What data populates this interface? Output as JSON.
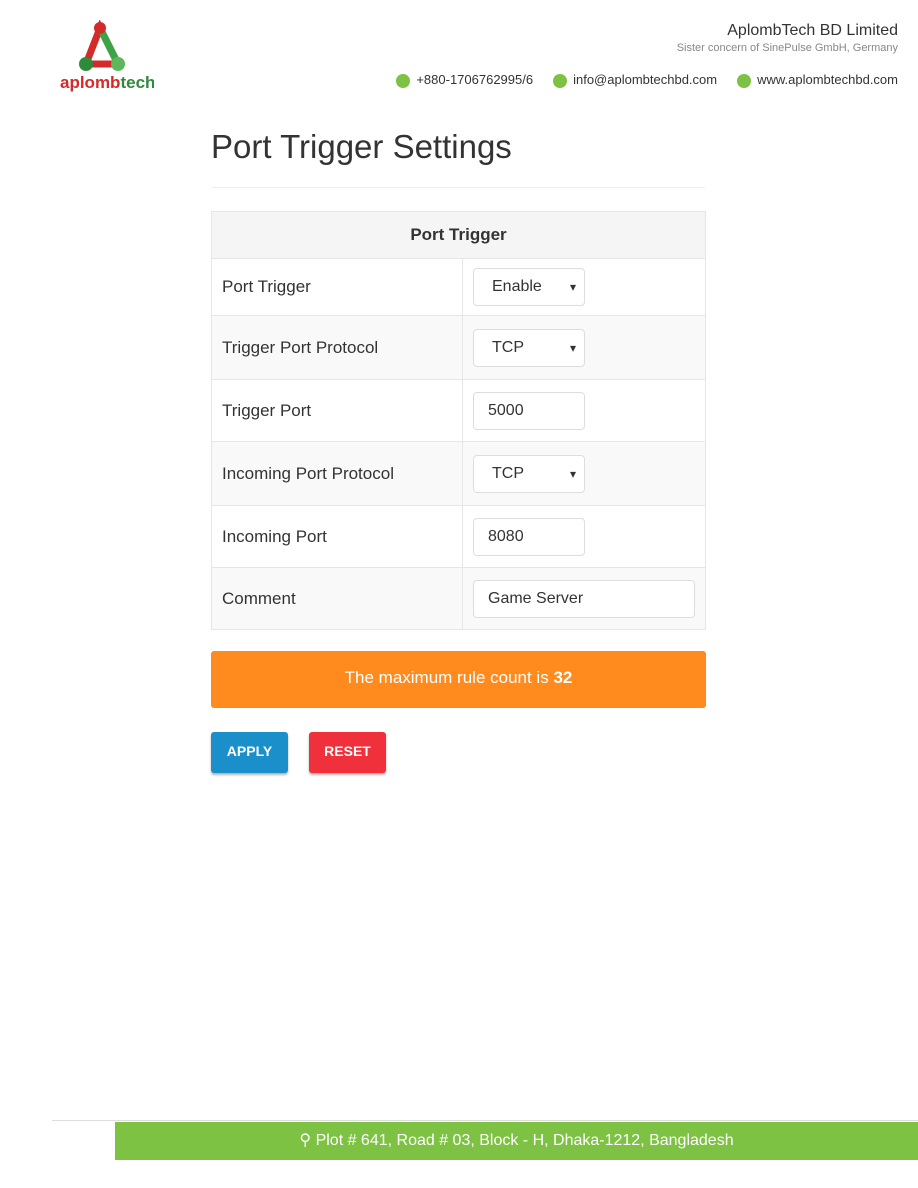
{
  "header": {
    "logo_text": "aplombtech",
    "company": "AplombTech BD Limited",
    "sister": "Sister concern of SinePulse GmbH, Germany",
    "contacts": [
      {
        "icon": "phone-icon",
        "text": "+880-1706762995/6"
      },
      {
        "icon": "mail-icon",
        "text": "info@aplombtechbd.com"
      },
      {
        "icon": "globe-icon",
        "text": "www.aplombtechbd.com"
      }
    ]
  },
  "page": {
    "title": "Port Trigger Settings"
  },
  "table": {
    "header": "Port Trigger",
    "rows": [
      {
        "label": "Port Trigger",
        "type": "select",
        "value": "Enable"
      },
      {
        "label": "Trigger Port Protocol",
        "type": "select",
        "value": "TCP"
      },
      {
        "label": "Trigger Port",
        "type": "input",
        "value": "5000"
      },
      {
        "label": "Incoming Port Protocol",
        "type": "select",
        "value": "TCP"
      },
      {
        "label": "Incoming Port",
        "type": "input",
        "value": "8080"
      },
      {
        "label": "Comment",
        "type": "input",
        "value": "Game Server"
      }
    ]
  },
  "notice": {
    "text": "The maximum rule count is ",
    "count": "32"
  },
  "buttons": {
    "apply": "APPLY",
    "reset": "RESET"
  },
  "colors": {
    "notice": "#ff8a1e",
    "apply": "#1a8fc9",
    "reset": "#f0303a",
    "footer": "#7dc242"
  },
  "footer": {
    "address": "Plot # 641, Road # 03, Block - H, Dhaka-1212, Bangladesh"
  }
}
